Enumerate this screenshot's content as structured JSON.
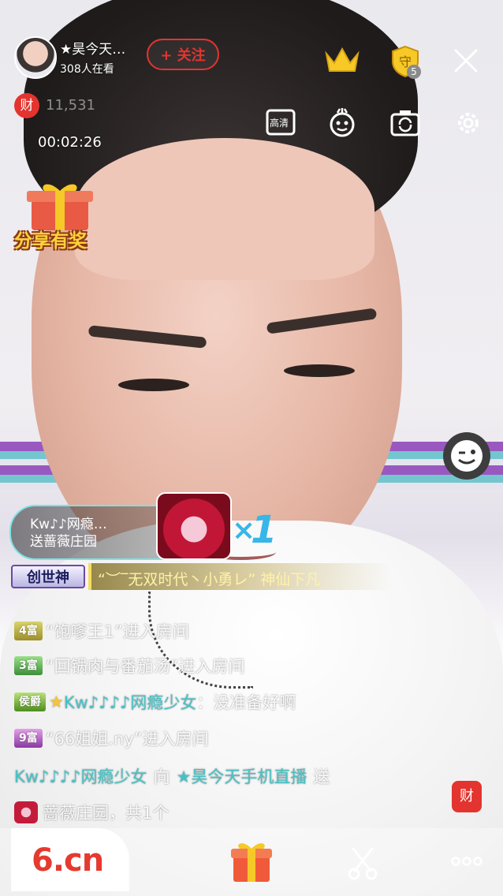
{
  "header": {
    "anchor_name": "★昊今天…",
    "viewer_count": "308人在看",
    "follow_label": "+ 关注",
    "guard_count": "5"
  },
  "stats": {
    "wealth_badge": "财",
    "wealth_value": "11,531",
    "live_timer": "00:02:26"
  },
  "toolbar": {
    "hd_label": "高清"
  },
  "promo": {
    "share_reward": "分享有奖"
  },
  "gift_banner": {
    "sender": "Kw♪♪网瘾…",
    "action": "送蔷薇庄园",
    "multiplier_symbol": "×",
    "count": "1"
  },
  "god_banner": {
    "badge": "创世神",
    "text": "“︶‾无双时代丶小勇レ” 神仙下凡"
  },
  "chat": [
    {
      "badge": "4富",
      "badge_class": "lv4",
      "text": "“饱嗲王1”进入房间"
    },
    {
      "badge": "3富",
      "badge_class": "lv3",
      "text": "“回锅肉与番茄汤”进入房间"
    },
    {
      "badge": "侯爵",
      "badge_class": "lvh",
      "user": "Kw♪♪♪♪网瘾少女",
      "text": "：没准备好啊"
    },
    {
      "badge": "9富",
      "badge_class": "lv9",
      "text": "“66姐姐.ny”进入房间"
    }
  ],
  "gift_message": {
    "sender": "Kw♪♪♪♪网瘾少女",
    "to": "向",
    "receiver": "★昊今天手机直播",
    "send": "送",
    "gift_line": "蔷薇庄园，共1个"
  },
  "bottom": {
    "logo": "6.cn",
    "fortune_label": "财"
  },
  "colors": {
    "accent_red": "#e3342f",
    "chat_cyan": "#46c2c6",
    "gift_blue": "#38b6e8"
  }
}
